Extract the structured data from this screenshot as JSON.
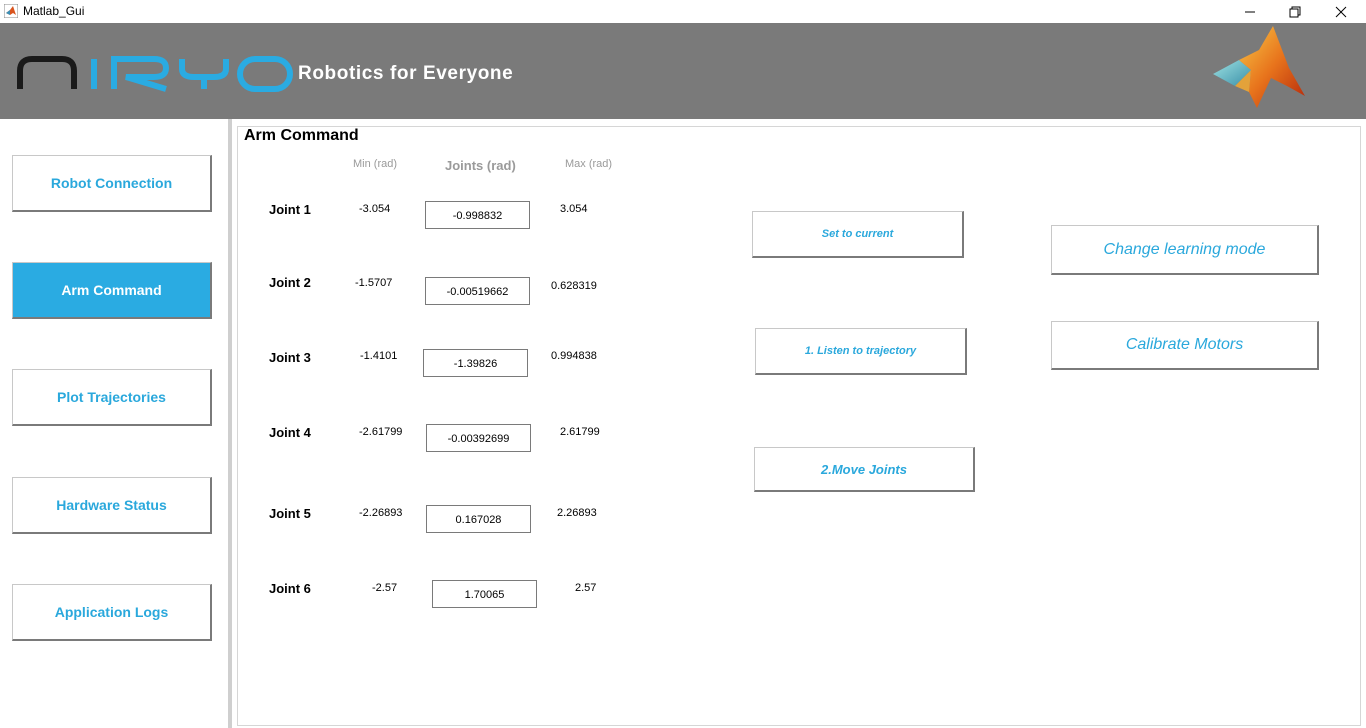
{
  "window": {
    "title": "Matlab_Gui",
    "controls": [
      "minimize-icon",
      "restore-icon",
      "close-icon"
    ]
  },
  "header": {
    "logo_text": "NIRYO",
    "tagline": "Robotics for Everyone",
    "brand_logo": "matlab-logo-icon"
  },
  "colors": {
    "header_bg": "#7a7a7a",
    "accent": "#2aabe2",
    "logo_dark": "#1a1a1a",
    "logo_blue": "#2aabe2"
  },
  "sidebar": {
    "items": [
      {
        "label": "Robot Connection",
        "active": false
      },
      {
        "label": "Arm Command",
        "active": true
      },
      {
        "label": "Plot Trajectories",
        "active": false
      },
      {
        "label": "Hardware Status",
        "active": false
      },
      {
        "label": "Application Logs",
        "active": false
      }
    ]
  },
  "panel": {
    "title": "Arm Command",
    "col_min": "Min (rad)",
    "col_joints": "Joints (rad)",
    "col_max": "Max (rad)",
    "joints": [
      {
        "label": "Joint 1",
        "min": "-3.054",
        "value": "-0.998832",
        "max": "3.054"
      },
      {
        "label": "Joint 2",
        "min": "-1.5707",
        "value": "-0.00519662",
        "max": "0.628319"
      },
      {
        "label": "Joint 3",
        "min": "-1.4101",
        "value": "-1.39826",
        "max": "0.994838"
      },
      {
        "label": "Joint 4",
        "min": "-2.61799",
        "value": "-0.00392699",
        "max": "2.61799"
      },
      {
        "label": "Joint 5",
        "min": "-2.26893",
        "value": "0.167028",
        "max": "2.26893"
      },
      {
        "label": "Joint 6",
        "min": "-2.57",
        "value": "1.70065",
        "max": "2.57"
      }
    ],
    "buttons": {
      "set_current": "Set to current",
      "listen": "1. Listen to trajectory",
      "move": "2.Move Joints",
      "learning": "Change learning mode",
      "calibrate": "Calibrate Motors"
    }
  }
}
